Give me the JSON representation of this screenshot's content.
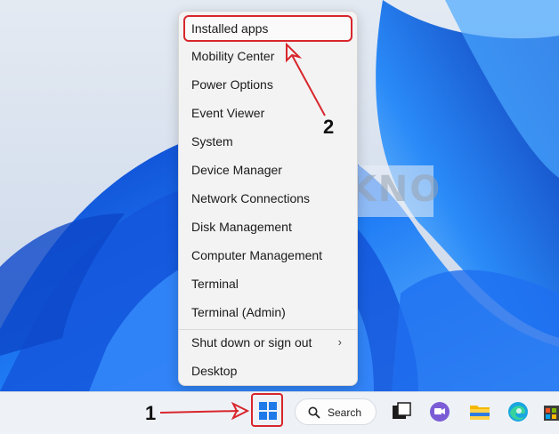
{
  "watermark": "BAGITEKNO",
  "menu": {
    "items": [
      {
        "label": "Installed apps",
        "highlight": true
      },
      {
        "label": "Mobility Center"
      },
      {
        "label": "Power Options"
      },
      {
        "label": "Event Viewer"
      },
      {
        "label": "System"
      },
      {
        "label": "Device Manager"
      },
      {
        "label": "Network Connections"
      },
      {
        "label": "Disk Management"
      },
      {
        "label": "Computer Management"
      },
      {
        "label": "Terminal"
      },
      {
        "label": "Terminal (Admin)"
      },
      {
        "label": "Shut down or sign out",
        "submenu": true
      },
      {
        "label": "Desktop"
      }
    ]
  },
  "taskbar": {
    "search_label": "Search",
    "icons": [
      "task-view-icon",
      "teams-chat-icon",
      "file-explorer-icon",
      "edge-icon",
      "store-icon"
    ]
  },
  "annotations": {
    "step1": "1",
    "step2": "2",
    "color": "#d8262c"
  },
  "colors": {
    "accent_red": "#d8262c",
    "menu_bg": "#f3f3f3",
    "wallpaper_blue": "#1a6ef0"
  }
}
